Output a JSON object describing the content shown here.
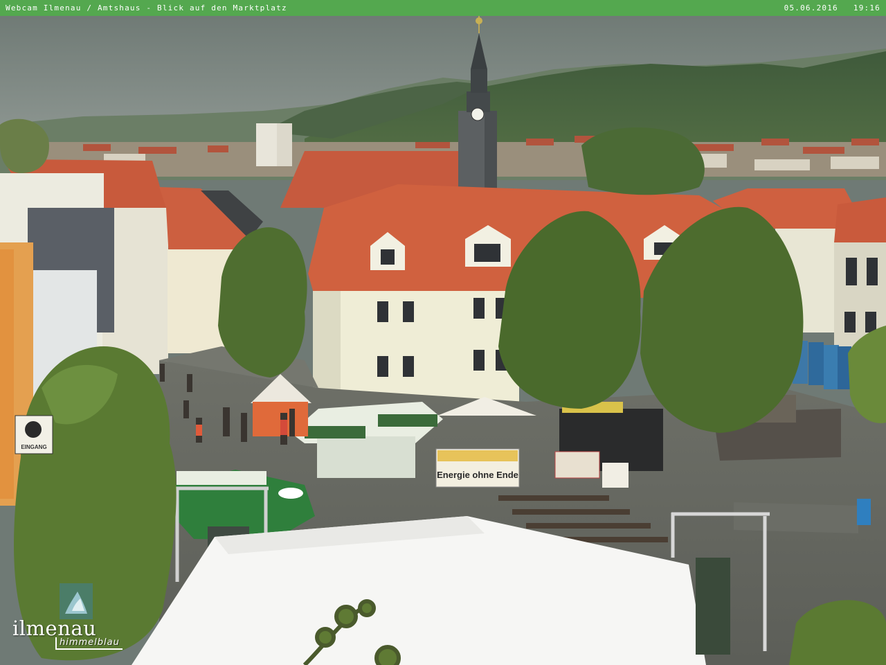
{
  "overlay": {
    "title": "Webcam Ilmenau / Amtshaus - Blick auf den Marktplatz",
    "date": "05.06.2016",
    "time": "19:16"
  },
  "logo": {
    "name": "ilmenau",
    "tagline": "himmelblau"
  },
  "signs": {
    "energy_banner": "Energie ohne Ende",
    "entrance_sign": "EINGANG"
  },
  "colors": {
    "bar": "#54a84f",
    "roof": "#c8553a",
    "facade": "#eeeedc",
    "tree": "#4e6a2a",
    "sky": "#747e7a"
  }
}
